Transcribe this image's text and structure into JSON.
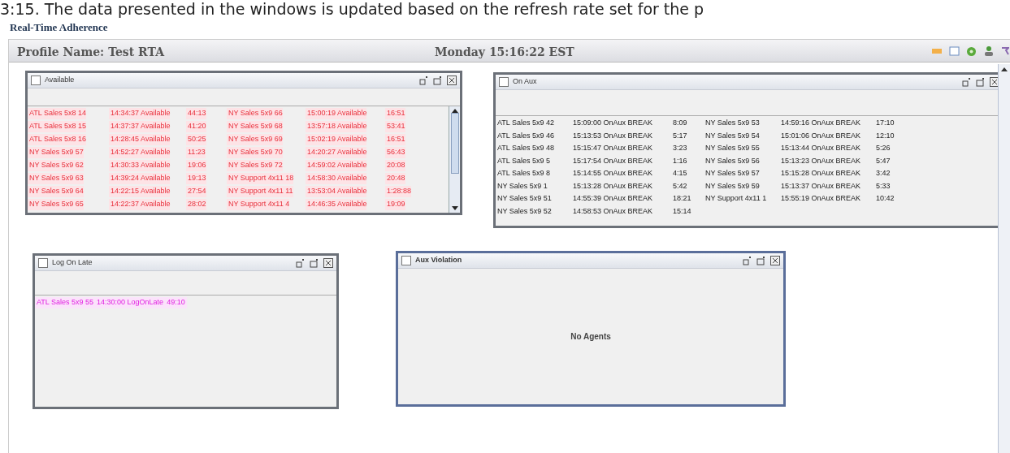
{
  "doc_text": "3:15. The data presented in the windows is updated based on the refresh rate set for the p",
  "heading": "Real-Time Adherence",
  "header": {
    "profile": "Profile Name: Test RTA",
    "clock": "Monday 15:16:22 EST"
  },
  "panels": [
    {
      "kind": "alert",
      "title": "Available",
      "rows": [
        [
          {
            "agent": "ATL Sales 5x8 14",
            "status": "14:34:37 Available",
            "duration": "44:13"
          },
          {
            "agent": "NY Sales 5x9 66",
            "status": "15:00:19 Available",
            "duration": "16:51"
          }
        ],
        [
          {
            "agent": "ATL Sales 5x8 15",
            "status": "14:37:37 Available",
            "duration": "41:20"
          },
          {
            "agent": "NY Sales 5x9 68",
            "status": "13:57:18 Available",
            "duration": "53:41"
          }
        ],
        [
          {
            "agent": "ATL Sales 5x8 16",
            "status": "14:28:45 Available",
            "duration": "50:25"
          },
          {
            "agent": "NY Sales 5x9 69",
            "status": "15:02:19 Available",
            "duration": "16:51"
          }
        ],
        [
          {
            "agent": "NY Sales 5x9 57",
            "status": "14:52:27 Available",
            "duration": "11:23"
          },
          {
            "agent": "NY Sales 5x9 70",
            "status": "14:20:27 Available",
            "duration": "56:43"
          }
        ],
        [
          {
            "agent": "NY Sales 5x9 62",
            "status": "14:30:33 Available",
            "duration": "19:06"
          },
          {
            "agent": "NY Sales 5x9 72",
            "status": "14:59:02 Available",
            "duration": "20:08"
          }
        ],
        [
          {
            "agent": "NY Sales 5x9 63",
            "status": "14:39:24 Available",
            "duration": "19:13"
          },
          {
            "agent": "NY Support 4x11 18",
            "status": "14:58:30 Available",
            "duration": "20:48"
          }
        ],
        [
          {
            "agent": "NY Sales 5x9 64",
            "status": "14:22:15 Available",
            "duration": "27:54"
          },
          {
            "agent": "NY Support 4x11 11",
            "status": "13:53:04 Available",
            "duration": "1:28:88"
          }
        ],
        [
          {
            "agent": "NY Sales 5x9 65",
            "status": "14:22:37 Available",
            "duration": "28:02"
          },
          {
            "agent": "NY Support 4x11 4",
            "status": "14:46:35 Available",
            "duration": "19:09"
          }
        ]
      ]
    },
    {
      "kind": "plain",
      "title": "On Aux",
      "rows": [
        [
          {
            "agent": "ATL Sales 5x9 42",
            "status": "15:09:00 OnAux BREAK",
            "duration": "8:09"
          },
          {
            "agent": "NY Sales 5x9 53",
            "status": "14:59:16 OnAux BREAK",
            "duration": "17:10"
          }
        ],
        [
          {
            "agent": "ATL Sales 5x9 46",
            "status": "15:13:53 OnAux BREAK",
            "duration": "5:17"
          },
          {
            "agent": "NY Sales 5x9 54",
            "status": "15:01:06 OnAux BREAK",
            "duration": "12:10"
          }
        ],
        [
          {
            "agent": "ATL Sales 5x9 48",
            "status": "15:15:47 OnAux BREAK",
            "duration": "3:23"
          },
          {
            "agent": "NY Sales 5x9 55",
            "status": "15:13:44 OnAux BREAK",
            "duration": "5:26"
          }
        ],
        [
          {
            "agent": "ATL Sales 5x9 5",
            "status": "15:17:54 OnAux BREAK",
            "duration": "1:16"
          },
          {
            "agent": "NY Sales 5x9 56",
            "status": "15:13:23 OnAux BREAK",
            "duration": "5:47"
          }
        ],
        [
          {
            "agent": "ATL Sales 5x9 8",
            "status": "15:14:55 OnAux BREAK",
            "duration": "4:15"
          },
          {
            "agent": "NY Sales 5x9 57",
            "status": "15:15:28 OnAux BREAK",
            "duration": "3:42"
          }
        ],
        [
          {
            "agent": "NY Sales 5x9 1",
            "status": "15:13:28 OnAux BREAK",
            "duration": "5:42"
          },
          {
            "agent": "NY Sales 5x9 59",
            "status": "15:13:37 OnAux BREAK",
            "duration": "5:33"
          }
        ],
        [
          {
            "agent": "NY Sales 5x9 51",
            "status": "14:55:39 OnAux BREAK",
            "duration": "18:21"
          },
          {
            "agent": "NY Support 4x11 1",
            "status": "15:55:19 OnAux BREAK",
            "duration": "10:42"
          }
        ],
        [
          {
            "agent": "NY Sales 5x9 52",
            "status": "14:58:53 OnAux BREAK",
            "duration": "15:14"
          }
        ]
      ]
    },
    {
      "kind": "late",
      "title": "Log On Late",
      "rows": [
        [
          {
            "agent": "ATL Sales 5x9 55",
            "status": "14:30:00 LogOnLate",
            "duration": "49:10"
          }
        ]
      ]
    },
    {
      "kind": "empty",
      "title": "Aux Violation",
      "message": "No Agents"
    }
  ]
}
